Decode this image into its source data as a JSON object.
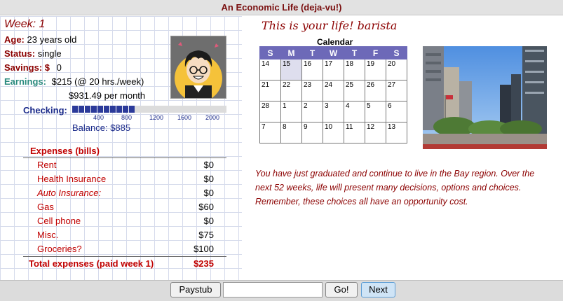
{
  "app": {
    "title": "An Economic Life (deja-vu!)"
  },
  "profile": {
    "week_label": "Week: 1",
    "age_label": "Age:",
    "age_value": "23 years old",
    "status_label": "Status:",
    "status_value": "single",
    "savings_label": "Savings: $",
    "savings_value": "0",
    "earnings_label": "Earnings:",
    "earnings_weekly": "$215 (@ 20 hrs./week)",
    "earnings_monthly": "$931.49 per month"
  },
  "checking": {
    "label": "Checking:",
    "ticks": [
      "400",
      "800",
      "1200",
      "1600",
      "2000"
    ],
    "balance_text": "Balance: $885",
    "balance_value": 885,
    "max_value": 2200,
    "fill_color": "#2b3a9a"
  },
  "expenses": {
    "title": "Expenses (bills)",
    "rows": [
      {
        "name": "Rent",
        "value": "$0"
      },
      {
        "name": "Health Insurance",
        "value": "$0"
      },
      {
        "name": "Auto Insurance:",
        "value": "$0"
      },
      {
        "name": "Gas",
        "value": "$60"
      },
      {
        "name": "Cell phone",
        "value": "$0"
      },
      {
        "name": "Misc.",
        "value": "$75"
      },
      {
        "name": "Groceries?",
        "value": "$100"
      }
    ],
    "total_label": "Total expenses (paid week 1)",
    "total_value": "$235"
  },
  "career_text": "This is your life! barista",
  "calendar": {
    "title": "Calendar",
    "days": [
      "S",
      "M",
      "T",
      "W",
      "T",
      "F",
      "S"
    ],
    "weeks": [
      [
        "14",
        "15",
        "16",
        "17",
        "18",
        "19",
        "20"
      ],
      [
        "21",
        "22",
        "23",
        "24",
        "25",
        "26",
        "27"
      ],
      [
        "28",
        "1",
        "2",
        "3",
        "4",
        "5",
        "6"
      ],
      [
        "7",
        "8",
        "9",
        "10",
        "11",
        "12",
        "13"
      ]
    ],
    "current_day": "15",
    "header_color": "#6d69b8"
  },
  "narrative": "You have just graduated and continue to live in the Bay region. Over the next 52 weeks, life will present many decisions, options and choices. Remember, these choices all have an opportunity cost.",
  "controls": {
    "paystub_label": "Paystub",
    "code_input_value": "",
    "go_label": "Go!",
    "next_label": "Next"
  }
}
